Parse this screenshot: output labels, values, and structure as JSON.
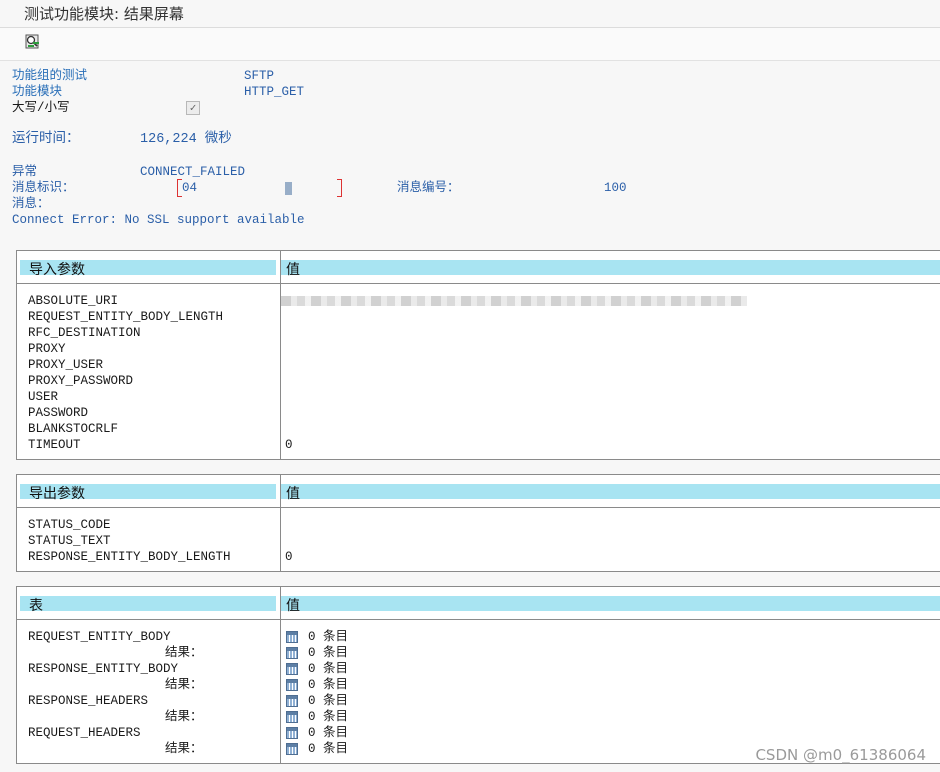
{
  "window": {
    "title": "测试功能模块: 结果屏幕"
  },
  "toolbar": {
    "icon": "debug-execute-icon"
  },
  "summary": {
    "group_label": "功能组的测试",
    "group_value": "SFTP",
    "module_label": "功能模块",
    "module_value": "HTTP_GET",
    "case_label": "大写/小写",
    "case_checked": true,
    "runtime_label": "运行时间：",
    "runtime_value": "126,224 微秒",
    "exception_label": "异常",
    "exception_value": "CONNECT_FAILED",
    "msg_id_label": "消息标识：",
    "msg_id_value": "04",
    "msg_no_label": "消息编号：",
    "msg_no_value": "100",
    "message_label": "消息：",
    "message_text": "Connect Error: No SSL support available"
  },
  "import": {
    "header_left": "导入参数",
    "header_right": "值",
    "params": [
      "ABSOLUTE_URI",
      "REQUEST_ENTITY_BODY_LENGTH",
      "RFC_DESTINATION",
      "PROXY",
      "PROXY_USER",
      "PROXY_PASSWORD",
      "USER",
      "PASSWORD",
      "BLANKSTOCRLF",
      "TIMEOUT"
    ],
    "timeout_value": "0"
  },
  "export": {
    "header_left": "导出参数",
    "header_right": "值",
    "params": [
      "STATUS_CODE",
      "STATUS_TEXT",
      "RESPONSE_ENTITY_BODY_LENGTH"
    ],
    "length_value": "0"
  },
  "tables": {
    "header_left": "表",
    "header_right": "值",
    "result_label": "结果：",
    "names": [
      "REQUEST_ENTITY_BODY",
      "RESPONSE_ENTITY_BODY",
      "RESPONSE_HEADERS",
      "REQUEST_HEADERS"
    ],
    "entries": "0 条目"
  },
  "watermark": "CSDN @m0_61386064"
}
